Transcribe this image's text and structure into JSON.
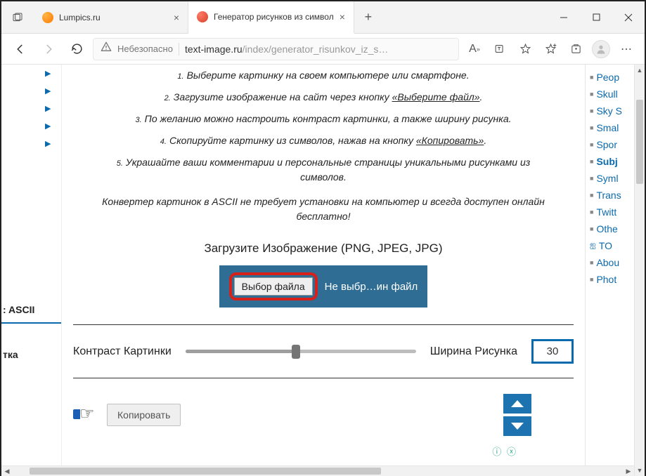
{
  "browser": {
    "tabs": [
      {
        "title": "Lumpics.ru",
        "active": false
      },
      {
        "title": "Генератор рисунков из символ",
        "active": true
      }
    ],
    "security_label": "Небезопасно",
    "url_host": "text-image.ru",
    "url_path": "/index/generator_risunkov_iz_s…"
  },
  "instructions": [
    {
      "n": "1.",
      "text": "Выберите картинку на своем компьютере или смартфоне."
    },
    {
      "n": "2.",
      "text_before": "Загрузите изображение на сайт через кнопку ",
      "link": "«Выберите файл»",
      "text_after": "."
    },
    {
      "n": "3.",
      "text": "По желанию можно настроить контраст картинки, а также ширину рисунка."
    },
    {
      "n": "4.",
      "text_before": "Скопируйте картинку из символов, нажав на кнопку ",
      "link": "«Копировать»",
      "text_after": "."
    },
    {
      "n": "5.",
      "text": "Украшайте ваши комментарии и персональные страницы уникальными рисунками из символов."
    }
  ],
  "tagline": "Конвертер картинок в ASCII не требует установки на компьютер и всегда доступен онлайн бесплатно!",
  "upload": {
    "label": "Загрузите Изображение (PNG, JPEG, JPG)",
    "choose": "Выбор файла",
    "status": "Не выбр…ин файл"
  },
  "controls": {
    "contrast_label": "Контраст Картинки",
    "width_label": "Ширина Рисунка",
    "width_value": "30",
    "copy_label": "Копировать"
  },
  "left_sidebar": {
    "item1": ": ASCII",
    "item2": "тка"
  },
  "right_links": [
    "Peop",
    "Skull",
    "Sky S",
    "Smal",
    "Spor",
    "Subj",
    "Syml",
    "Trans",
    "Twitt",
    "Othe",
    "TO",
    "Abou",
    "Phot"
  ]
}
